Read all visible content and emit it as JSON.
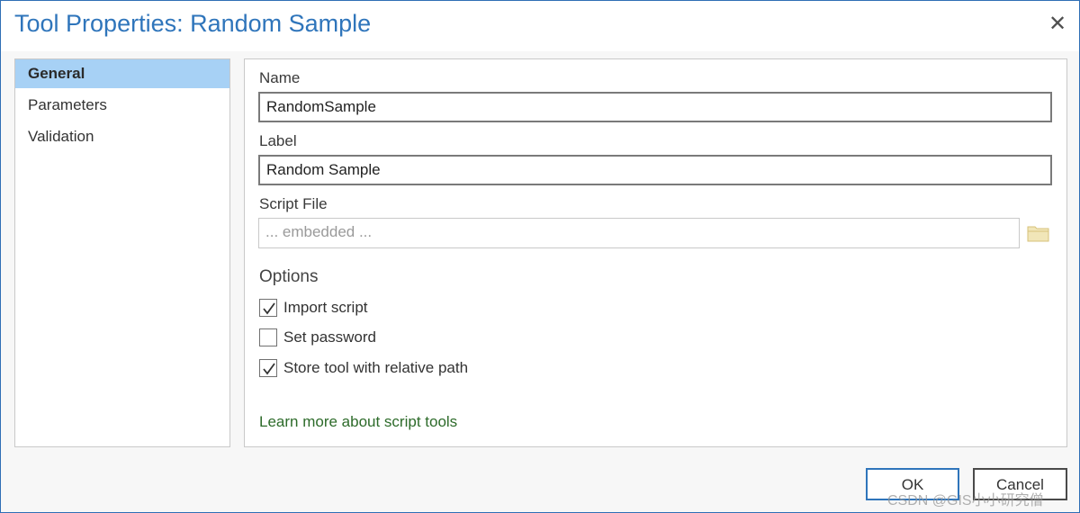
{
  "window": {
    "title": "Tool Properties: Random Sample",
    "close_glyph": "✕"
  },
  "sidebar": {
    "items": [
      {
        "label": "General",
        "active": true
      },
      {
        "label": "Parameters",
        "active": false
      },
      {
        "label": "Validation",
        "active": false
      }
    ]
  },
  "general": {
    "name_label": "Name",
    "name_value": "RandomSample",
    "label_label": "Label",
    "label_value": "Random Sample",
    "script_file_label": "Script File",
    "script_file_placeholder": "... embedded ...",
    "folder_icon": "folder-icon",
    "options_heading": "Options",
    "options": [
      {
        "label": "Import script",
        "checked": true
      },
      {
        "label": "Set password",
        "checked": false
      },
      {
        "label": "Store tool with relative path",
        "checked": true
      }
    ],
    "learn_more_link": "Learn more about script tools"
  },
  "footer": {
    "ok_label": "OK",
    "cancel_label": "Cancel"
  },
  "watermark": "CSDN @GIS小小研究僧",
  "colors": {
    "title": "#2f75bb",
    "selected_item": "#a7d1f5",
    "link": "#2d6b2a",
    "ok_border": "#2f75bb",
    "folder": "#e8d9a0"
  }
}
